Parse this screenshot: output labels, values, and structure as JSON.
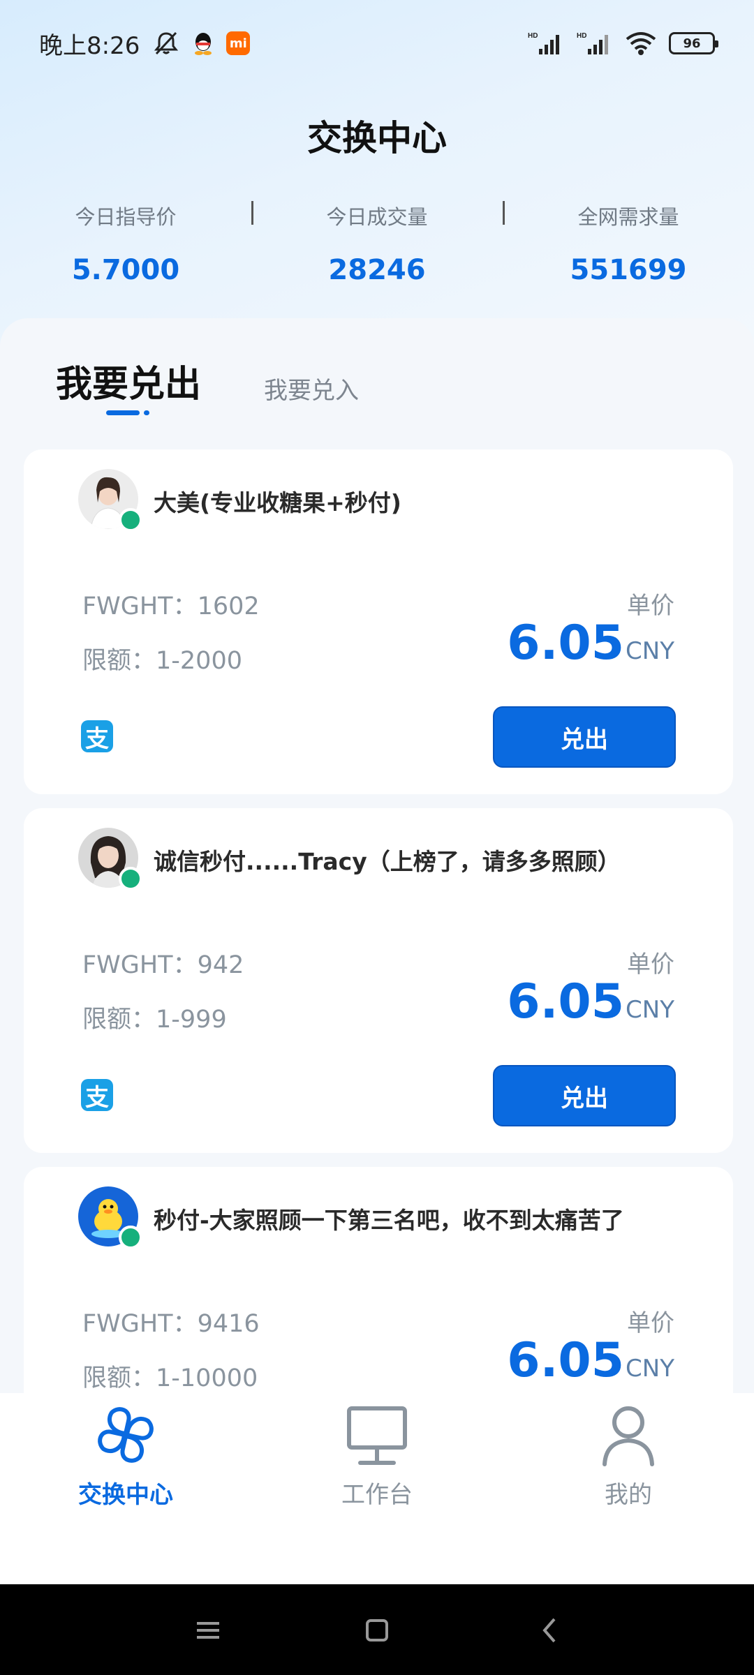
{
  "status_bar": {
    "time": "晚上8:26",
    "battery": "96",
    "left_icons": [
      "mute-icon",
      "qq-icon",
      "mi-icon"
    ],
    "right_icons": [
      "hd-signal-icon",
      "hd-signal-icon",
      "wifi-icon",
      "battery-icon"
    ],
    "mi_label": "mi"
  },
  "header": {
    "title": "交换中心"
  },
  "stats": [
    {
      "label": "今日指导价",
      "value": "5.7000"
    },
    {
      "label": "今日成交量",
      "value": "28246"
    },
    {
      "label": "全网需求量",
      "value": "551699"
    }
  ],
  "tabs": {
    "active": "我要兑出",
    "inactive": "我要兑入"
  },
  "listings": [
    {
      "name": "大美(专业收糖果+秒付)",
      "fwght_label": "FWGHT：",
      "fwght": "1602",
      "limit_label": "限额：",
      "limit": "1-2000",
      "price_label": "单价",
      "price": "6.05",
      "currency": "CNY",
      "pay_icon": "alipay-icon",
      "pay_glyph": "支",
      "button": "兑出"
    },
    {
      "name": "诚信秒付......Tracy（上榜了，请多多照顾）",
      "fwght_label": "FWGHT：",
      "fwght": "942",
      "limit_label": "限额：",
      "limit": "1-999",
      "price_label": "单价",
      "price": "6.05",
      "currency": "CNY",
      "pay_icon": "alipay-icon",
      "pay_glyph": "支",
      "button": "兑出"
    },
    {
      "name": "秒付-大家照顾一下第三名吧，收不到太痛苦了",
      "fwght_label": "FWGHT：",
      "fwght": "9416",
      "limit_label": "限额：",
      "limit": "1-10000",
      "price_label": "单价",
      "price": "6.05",
      "currency": "CNY"
    }
  ],
  "bottom_nav": [
    {
      "label": "交换中心",
      "icon": "pinwheel-icon",
      "active": true
    },
    {
      "label": "工作台",
      "icon": "monitor-icon",
      "active": false
    },
    {
      "label": "我的",
      "icon": "user-icon",
      "active": false
    }
  ],
  "colors": {
    "accent": "#0a6ae0",
    "online": "#16b07c",
    "alipay": "#1aa0e6",
    "nav_inactive": "#8a949e"
  }
}
